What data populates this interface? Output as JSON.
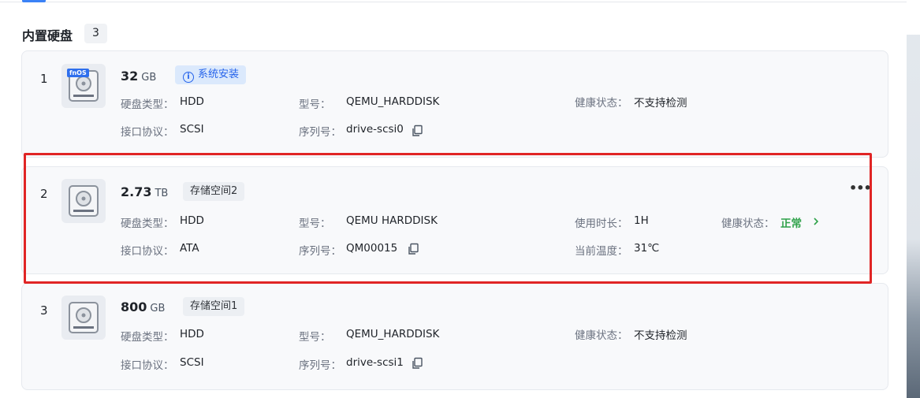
{
  "section": {
    "title": "内置硬盘",
    "count": "3"
  },
  "labels": {
    "disk_type": "硬盘类型：",
    "interface": "接口协议：",
    "model": "型号：",
    "serial": "序列号：",
    "health": "健康状态：",
    "uptime": "使用时长：",
    "temperature": "当前温度："
  },
  "disks": [
    {
      "index": "1",
      "badge": "fnOS",
      "capacity": "32",
      "unit": "GB",
      "tag": "系统安装",
      "tag_icon": "info-icon",
      "disk_type": "HDD",
      "interface": "SCSI",
      "model": "QEMU_HARDDISK",
      "serial": "drive-scsi0",
      "health": "不支持检测"
    },
    {
      "index": "2",
      "capacity": "2.73",
      "unit": "TB",
      "tag": "存储空间2",
      "disk_type": "HDD",
      "interface": "ATA",
      "model": "QEMU HARDDISK",
      "serial": "QM00015",
      "uptime": "1H",
      "temperature": "31℃",
      "health": "正常",
      "more": "•••"
    },
    {
      "index": "3",
      "capacity": "800",
      "unit": "GB",
      "tag": "存储空间1",
      "disk_type": "HDD",
      "interface": "SCSI",
      "model": "QEMU_HARDDISK",
      "serial": "drive-scsi1",
      "health": "不支持检测"
    }
  ],
  "colors": {
    "accent": "#3b82f6",
    "health_ok": "#2fa24a",
    "highlight": "#e02525"
  }
}
